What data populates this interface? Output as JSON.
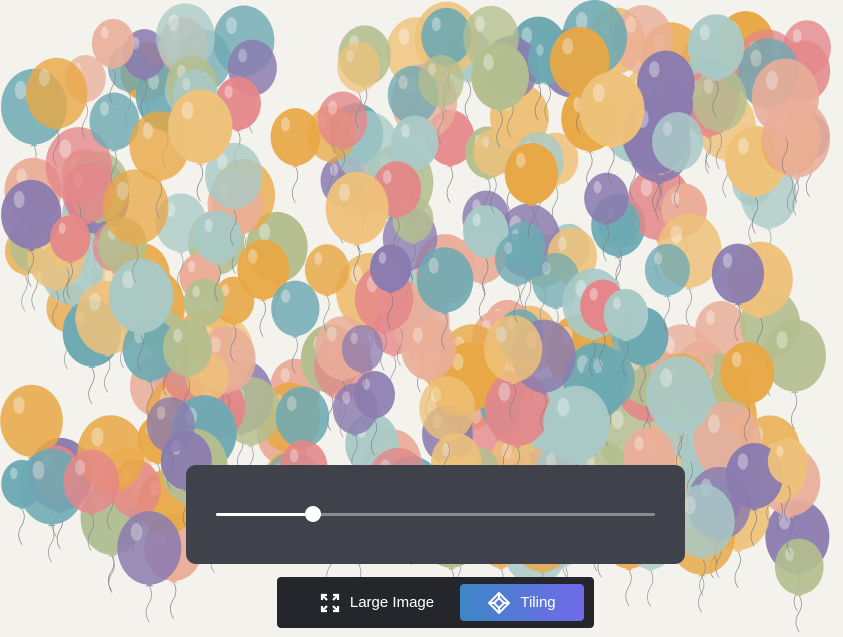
{
  "viewer": {
    "zoom_slider": {
      "value": 0.22,
      "min": 0,
      "max": 1
    },
    "mode_buttons": [
      {
        "label": "Large Image",
        "icon": "expand-icon",
        "active": false
      },
      {
        "label": "Tiling",
        "icon": "tiling-icon",
        "active": true
      }
    ]
  },
  "colors": {
    "background": "#f4f2ec",
    "balloons": [
      "#6eaab3",
      "#e9a845",
      "#e5878a",
      "#8b7cb0",
      "#eaae99",
      "#a9cac7",
      "#b4bf8f",
      "#efc27a"
    ],
    "panel": "#40424b",
    "accent_start": "#3d86c6",
    "accent_end": "#716ae9"
  }
}
